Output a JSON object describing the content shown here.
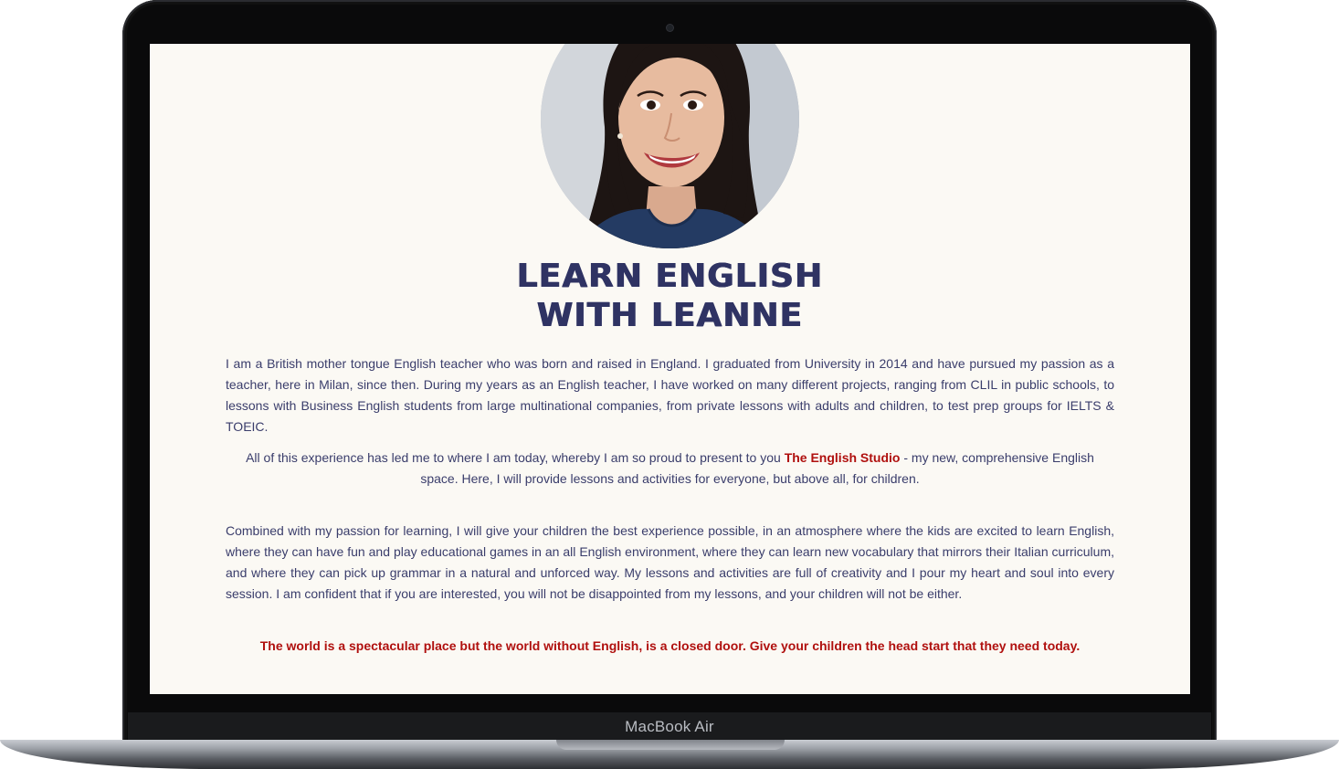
{
  "device": {
    "label": "MacBook Air"
  },
  "profile": {
    "photo": "portrait-photo"
  },
  "hero": {
    "title_line1": "LEARN ENGLISH",
    "title_line2": "WITH LEANNE"
  },
  "content": {
    "paragraph1": "I am a British mother tongue English teacher who was born and raised in England. I graduated from University in 2014 and have pursued my passion as a teacher, here in Milan, since then. During my years as an English teacher, I have worked on many different projects, ranging from CLIL in public schools, to lessons with Business English students from large multinational companies, from private lessons with adults and children, to test prep groups for IELTS & TOEIC.",
    "paragraph2_before": "All of this experience has led me to where I am today, whereby I am so proud to present to you ",
    "paragraph2_brand": "The English Studio",
    "paragraph2_after": " - my new, comprehensive English space. Here, I will provide lessons and activities for everyone, but above all, for children.",
    "paragraph3": "Combined with my passion for learning, I will give your children the best experience possible, in an atmosphere where the kids are excited to learn English, where they can have fun and play educational games in an all English environment, where they can learn new vocabulary that mirrors their Italian curriculum, and where they can pick up grammar in a natural and unforced way. My lessons and activities are full of creativity and I pour my heart and soul into every session. I am confident that if you are interested, you will not be disappointed from my lessons, and your children will not be either.",
    "closing_quote": "The world is a spectacular place but the world without English, is a closed door. Give your children the head start that they need today."
  },
  "colors": {
    "page_background": "#fbf9f4",
    "title": "#2f3363",
    "body_text": "#3a3d6b",
    "accent_red": "#b0100e"
  }
}
